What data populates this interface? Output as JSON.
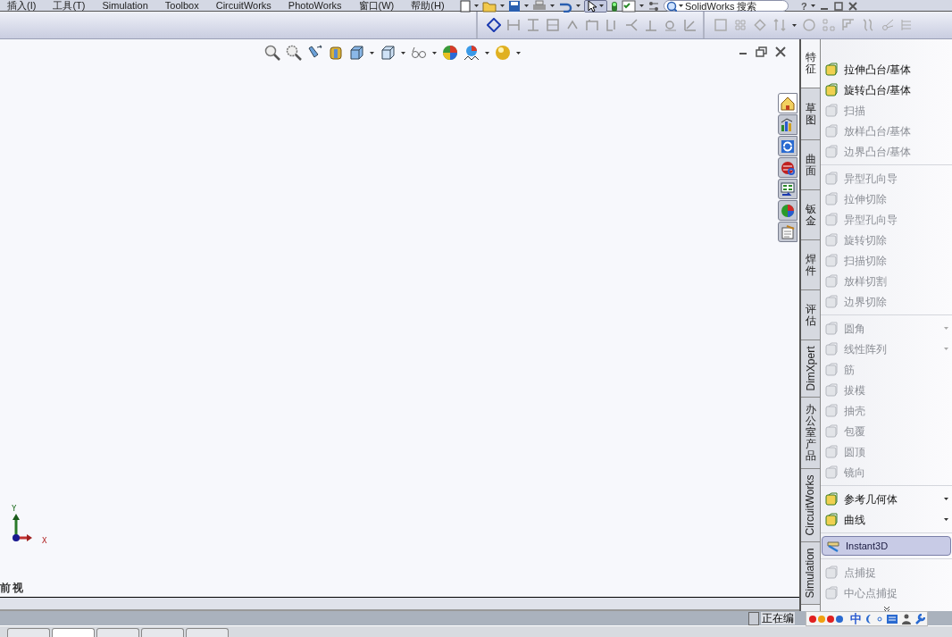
{
  "menu_bar": {
    "items": [
      "插入(I)",
      "工具(T)",
      "Simulation",
      "Toolbox",
      "CircuitWorks",
      "PhotoWorks",
      "窗口(W)",
      "帮助(H)"
    ],
    "search": {
      "placeholder": "SolidWorks 搜索"
    },
    "help": "?"
  },
  "viewport": {
    "view_name": "前视",
    "triad": {
      "x_label": "X",
      "y_label": "Y"
    }
  },
  "task_pane": {
    "tabs": [
      {
        "selected": true
      },
      {
        "selected": false
      },
      {
        "selected": false
      },
      {
        "selected": false
      },
      {
        "selected": false
      },
      {
        "selected": false
      },
      {
        "selected": false
      }
    ]
  },
  "command_manager": {
    "tabs": [
      {
        "label": "特征",
        "selected": true
      },
      {
        "label": "草图",
        "selected": false
      },
      {
        "label": "曲面",
        "selected": false
      },
      {
        "label": "钣金",
        "selected": false
      },
      {
        "label": "焊件",
        "selected": false
      },
      {
        "label": "评估",
        "selected": false
      },
      {
        "label": "DimXpert",
        "selected": false
      },
      {
        "label": "办公室产品",
        "selected": false
      },
      {
        "label": "CircuitWorks",
        "selected": false
      },
      {
        "label": "Simulation",
        "selected": false
      }
    ],
    "groups": [
      {
        "items": [
          {
            "label": "拉伸凸台/基体",
            "disabled": false,
            "dropdown": false
          },
          {
            "label": "旋转凸台/基体",
            "disabled": false,
            "dropdown": false
          },
          {
            "label": "扫描",
            "disabled": true,
            "dropdown": false
          },
          {
            "label": "放样凸台/基体",
            "disabled": true,
            "dropdown": false
          },
          {
            "label": "边界凸台/基体",
            "disabled": true,
            "dropdown": false
          }
        ]
      },
      {
        "items": [
          {
            "label": "异型孔向导",
            "disabled": true,
            "dropdown": false
          },
          {
            "label": "拉伸切除",
            "disabled": true,
            "dropdown": false
          },
          {
            "label": "异型孔向导",
            "disabled": true,
            "dropdown": false
          },
          {
            "label": "旋转切除",
            "disabled": true,
            "dropdown": false
          },
          {
            "label": "扫描切除",
            "disabled": true,
            "dropdown": false
          },
          {
            "label": "放样切割",
            "disabled": true,
            "dropdown": false
          },
          {
            "label": "边界切除",
            "disabled": true,
            "dropdown": false
          }
        ]
      },
      {
        "items": [
          {
            "label": "圆角",
            "disabled": true,
            "dropdown": true
          },
          {
            "label": "线性阵列",
            "disabled": true,
            "dropdown": true
          },
          {
            "label": "筋",
            "disabled": true,
            "dropdown": false
          },
          {
            "label": "拔模",
            "disabled": true,
            "dropdown": false
          },
          {
            "label": "抽壳",
            "disabled": true,
            "dropdown": false
          },
          {
            "label": "包覆",
            "disabled": true,
            "dropdown": false
          },
          {
            "label": "圆顶",
            "disabled": true,
            "dropdown": false
          },
          {
            "label": "镜向",
            "disabled": true,
            "dropdown": false
          }
        ]
      },
      {
        "items": [
          {
            "label": "参考几何体",
            "disabled": false,
            "dropdown": true
          },
          {
            "label": "曲线",
            "disabled": false,
            "dropdown": true
          }
        ]
      },
      {
        "toggle": {
          "label": "Instant3D",
          "on": true
        }
      },
      {
        "items": [
          {
            "label": "点捕捉",
            "disabled": true,
            "dropdown": false
          },
          {
            "label": "中心点捕捉",
            "disabled": true,
            "dropdown": false
          }
        ]
      }
    ]
  },
  "status_bar": {
    "text": "正在编",
    "ime": "中"
  },
  "sheet_tabs": [
    {
      "selected": false
    },
    {
      "selected": true
    },
    {
      "selected": false
    },
    {
      "selected": false
    },
    {
      "selected": false
    }
  ]
}
